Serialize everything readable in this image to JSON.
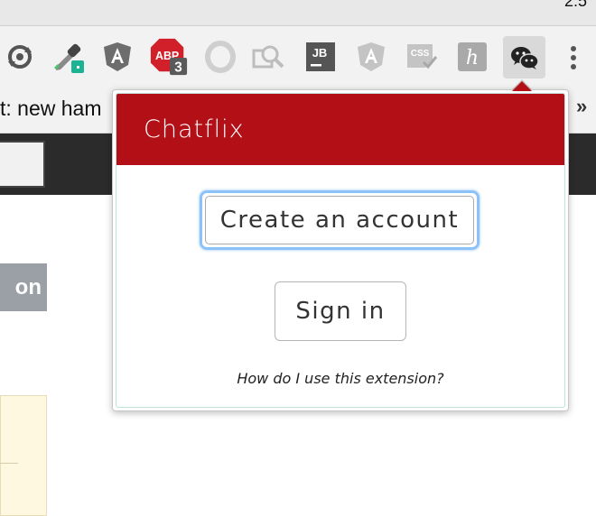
{
  "system": {
    "clock": "2:5"
  },
  "toolbar": {
    "extensions": [
      "sync-icon",
      "eyedropper-icon",
      "angular-icon",
      "adblock-icon",
      "opera-icon",
      "magnifier-icon",
      "jetbrains-icon",
      "angular-icon",
      "css-icon",
      "honey-icon",
      "wechat-icon"
    ],
    "adblock_badge": "3",
    "jetbrains_label": "JB",
    "css_label": "CSS",
    "adblock_label": "ABP"
  },
  "bookmarks": {
    "text": "t: new ham",
    "overflow": "»"
  },
  "page": {
    "button_fragment": "on"
  },
  "popup": {
    "title": "Chatflix",
    "create_account": "Create an account",
    "sign_in": "Sign in",
    "help": "How do I use this extension?",
    "brand_color": "#b30f17"
  }
}
